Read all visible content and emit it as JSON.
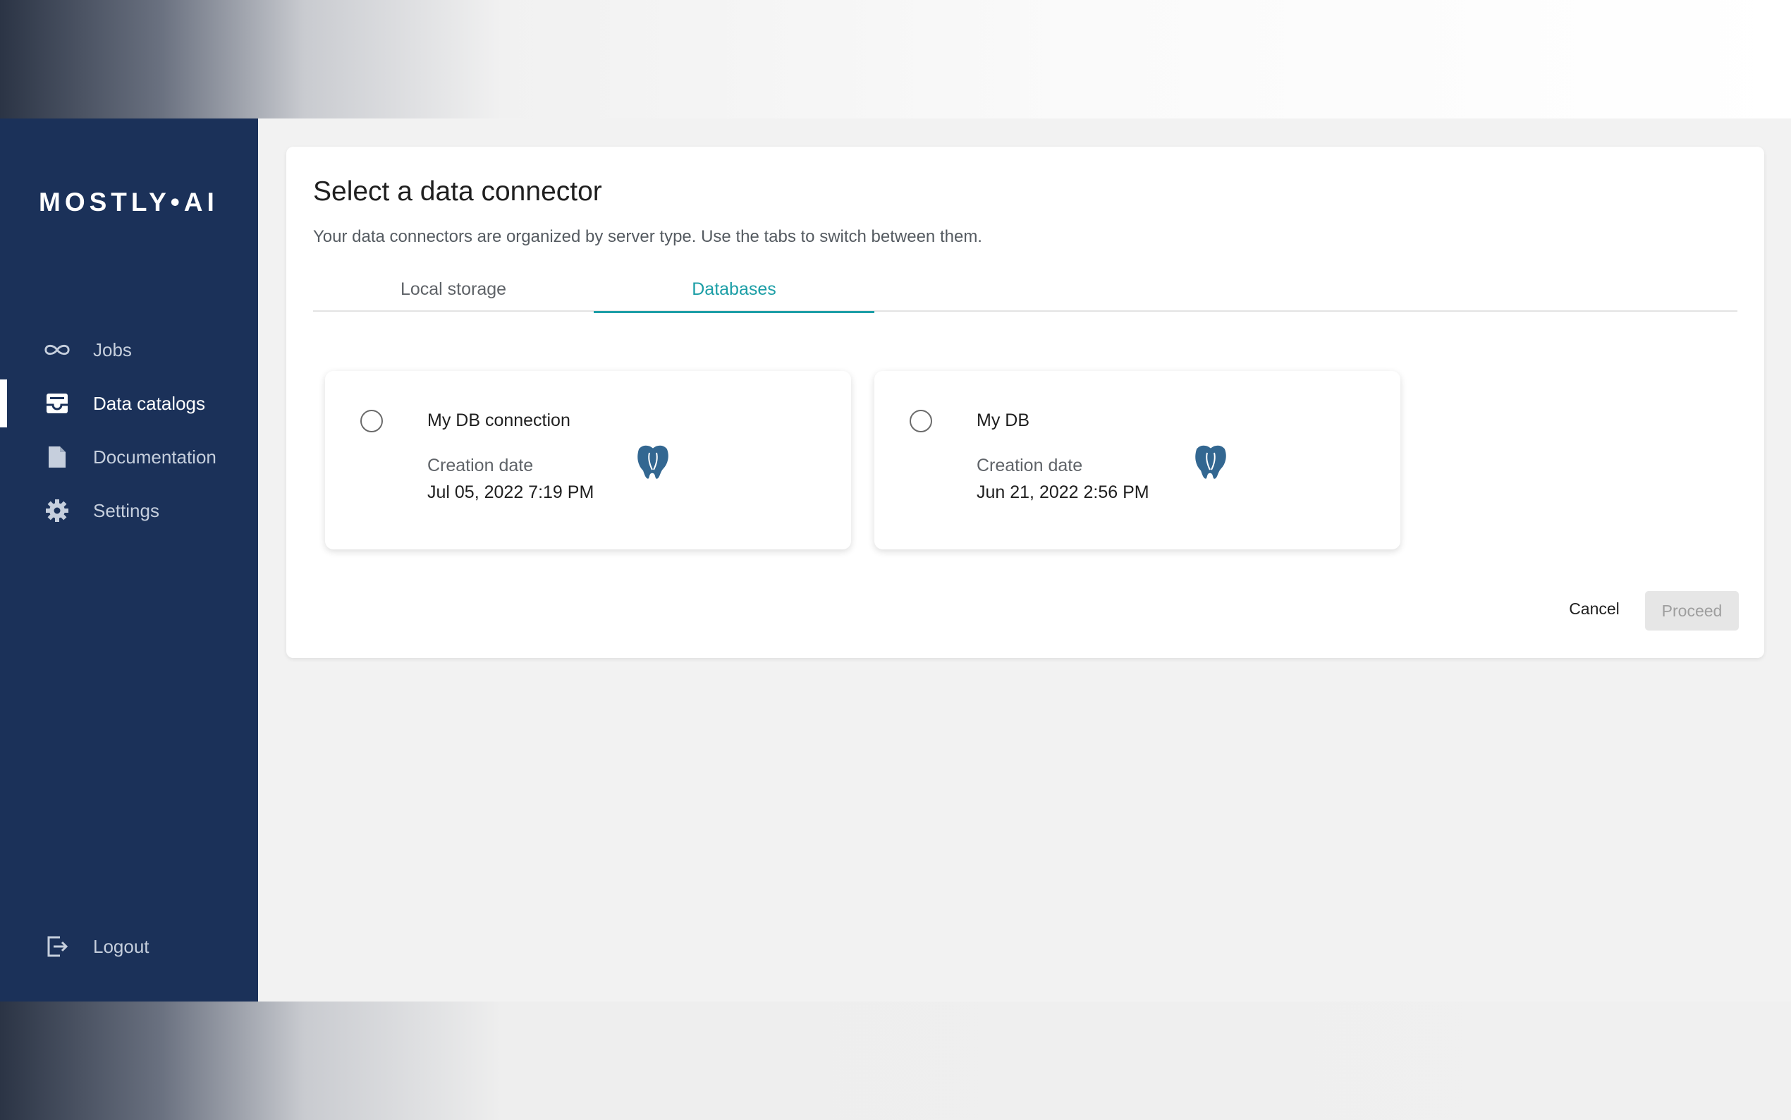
{
  "brand": {
    "logo_text": "MOSTLY•AI"
  },
  "sidebar": {
    "items": [
      {
        "label": "Jobs",
        "icon": "infinity-icon",
        "active": false
      },
      {
        "label": "Data catalogs",
        "icon": "inbox-icon",
        "active": true
      },
      {
        "label": "Documentation",
        "icon": "document-icon",
        "active": false
      },
      {
        "label": "Settings",
        "icon": "gear-icon",
        "active": false
      }
    ],
    "logout_label": "Logout",
    "logout_icon": "logout-icon"
  },
  "dialog": {
    "title": "Select a data connector",
    "subtitle": "Your data connectors are organized by server type. Use the tabs to switch between them.",
    "tabs": [
      {
        "label": "Local storage",
        "active": false
      },
      {
        "label": "Databases",
        "active": true
      }
    ],
    "connectors": [
      {
        "name": "My DB connection",
        "date_label": "Creation date",
        "date": "Jul 05, 2022 7:19 PM",
        "logo_icon": "postgresql-logo-icon",
        "selected": false
      },
      {
        "name": "My DB",
        "date_label": "Creation date",
        "date": "Jun 21, 2022 2:56 PM",
        "logo_icon": "postgresql-logo-icon",
        "selected": false
      }
    ],
    "cancel_label": "Cancel",
    "proceed_label": "Proceed",
    "proceed_disabled": true
  },
  "colors": {
    "sidebar_bg": "#1b3159",
    "accent": "#1c9ea6",
    "postgres_blue": "#336791"
  }
}
